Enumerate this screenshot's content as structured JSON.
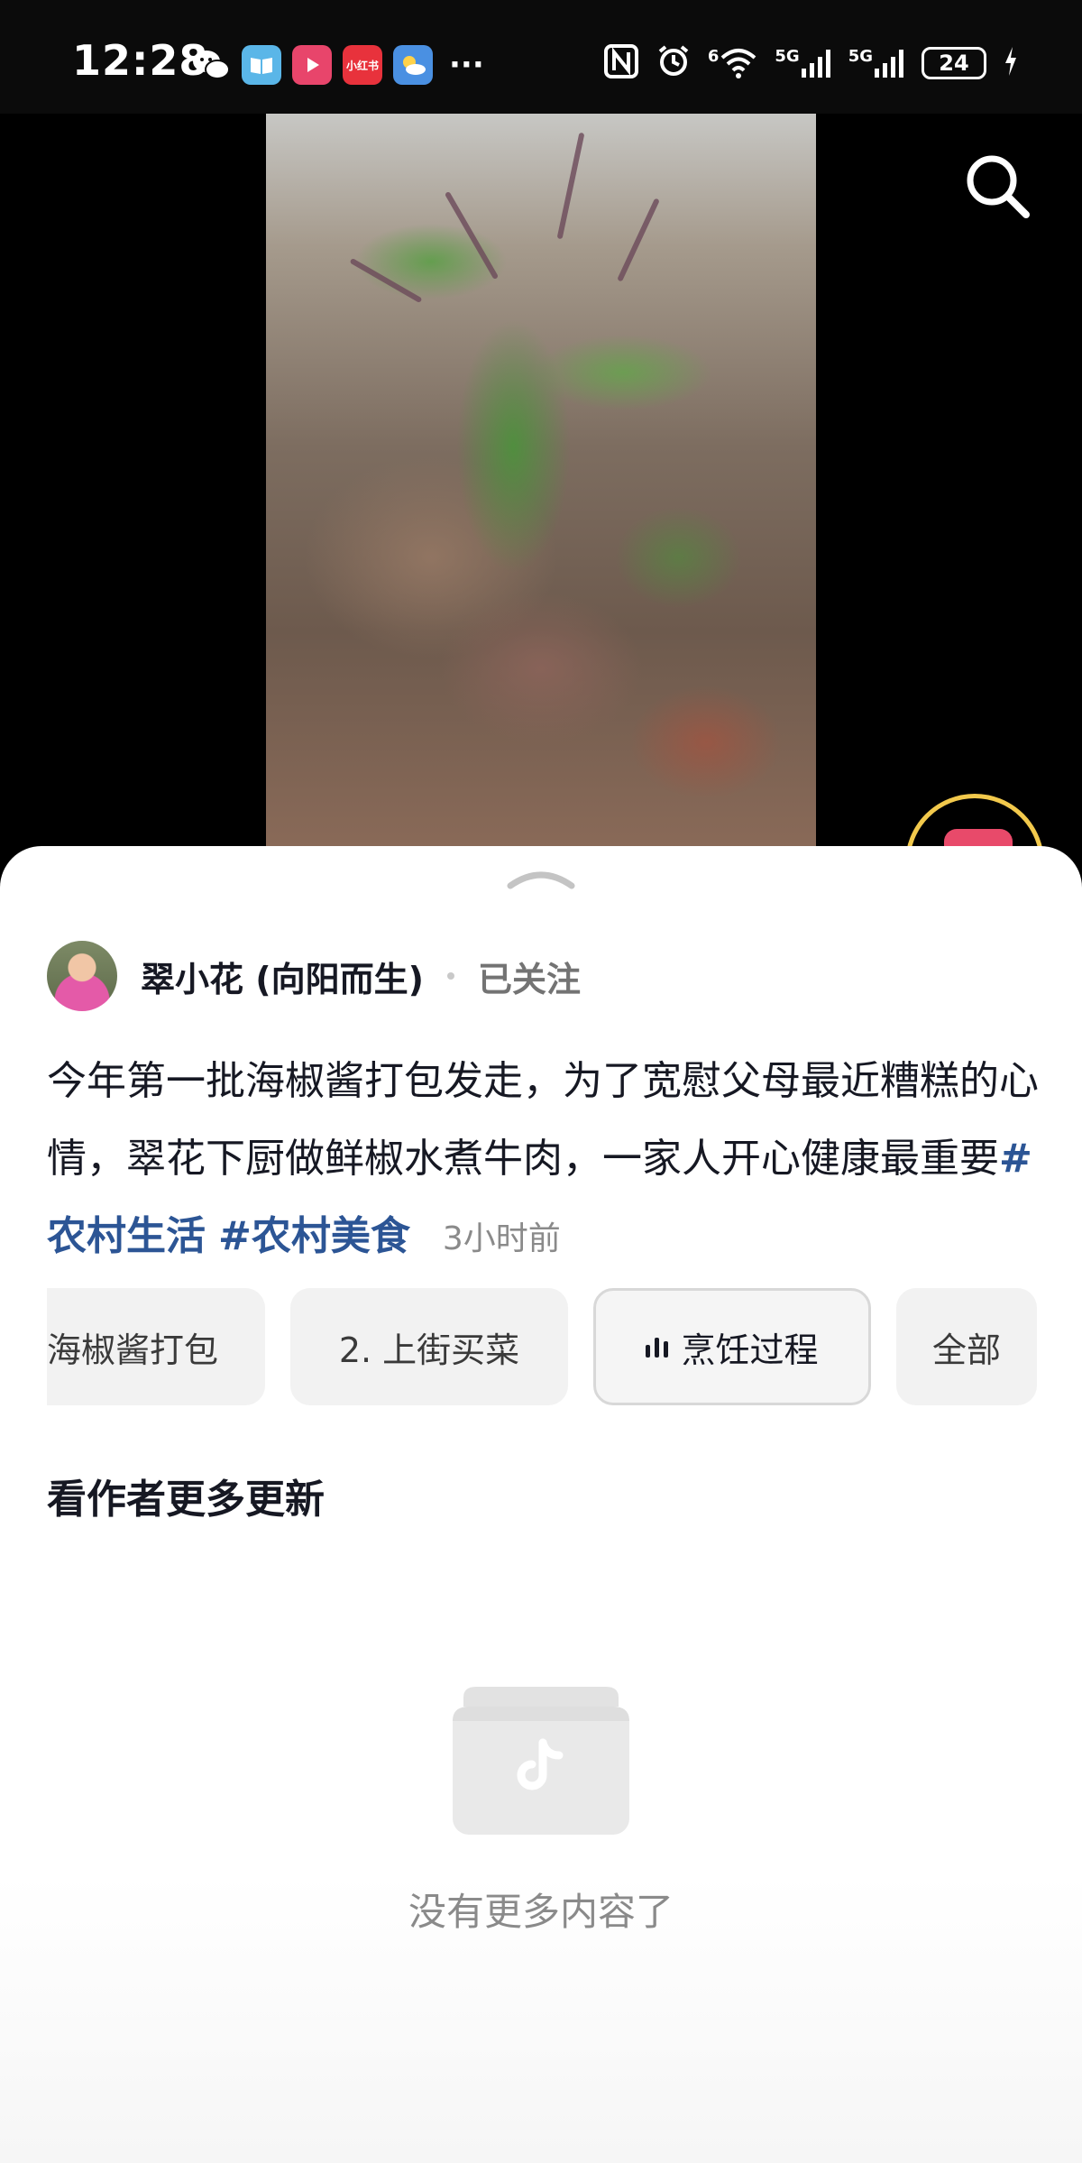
{
  "status_bar": {
    "time": "12:28",
    "more": "···",
    "xhs_label": "小红书",
    "sig1_label": "6",
    "sig2_label": "5G",
    "sig3_label": "5G",
    "battery": "24"
  },
  "author": {
    "name": "翠小花 (向阳而生)",
    "follow_status": "已关注"
  },
  "description": {
    "text": "今年第一批海椒酱打包发走，为了宽慰父母最近糟糕的心情，翠花下厨做鲜椒水煮牛肉，一家人开心健康最重要",
    "tags": [
      "#农村生活",
      "#农村美食"
    ],
    "time": "3小时前"
  },
  "chapters": [
    {
      "label": "海椒酱打包",
      "active": false
    },
    {
      "label": "2. 上街买菜",
      "active": false
    },
    {
      "label": "烹饪过程",
      "active": true
    },
    {
      "label": "全部",
      "active": false
    }
  ],
  "more_updates": {
    "title": "看作者更多更新",
    "empty_text": "没有更多内容了"
  },
  "icons": {
    "search": "search-icon",
    "empty": "tiktok-folder-icon",
    "grab": "chevron-up-icon",
    "playing": "audio-bars-icon"
  },
  "colors": {
    "tag": "#2c5595",
    "sheet_bg": "#ffffff",
    "accent_ring": "#f2c94c"
  }
}
